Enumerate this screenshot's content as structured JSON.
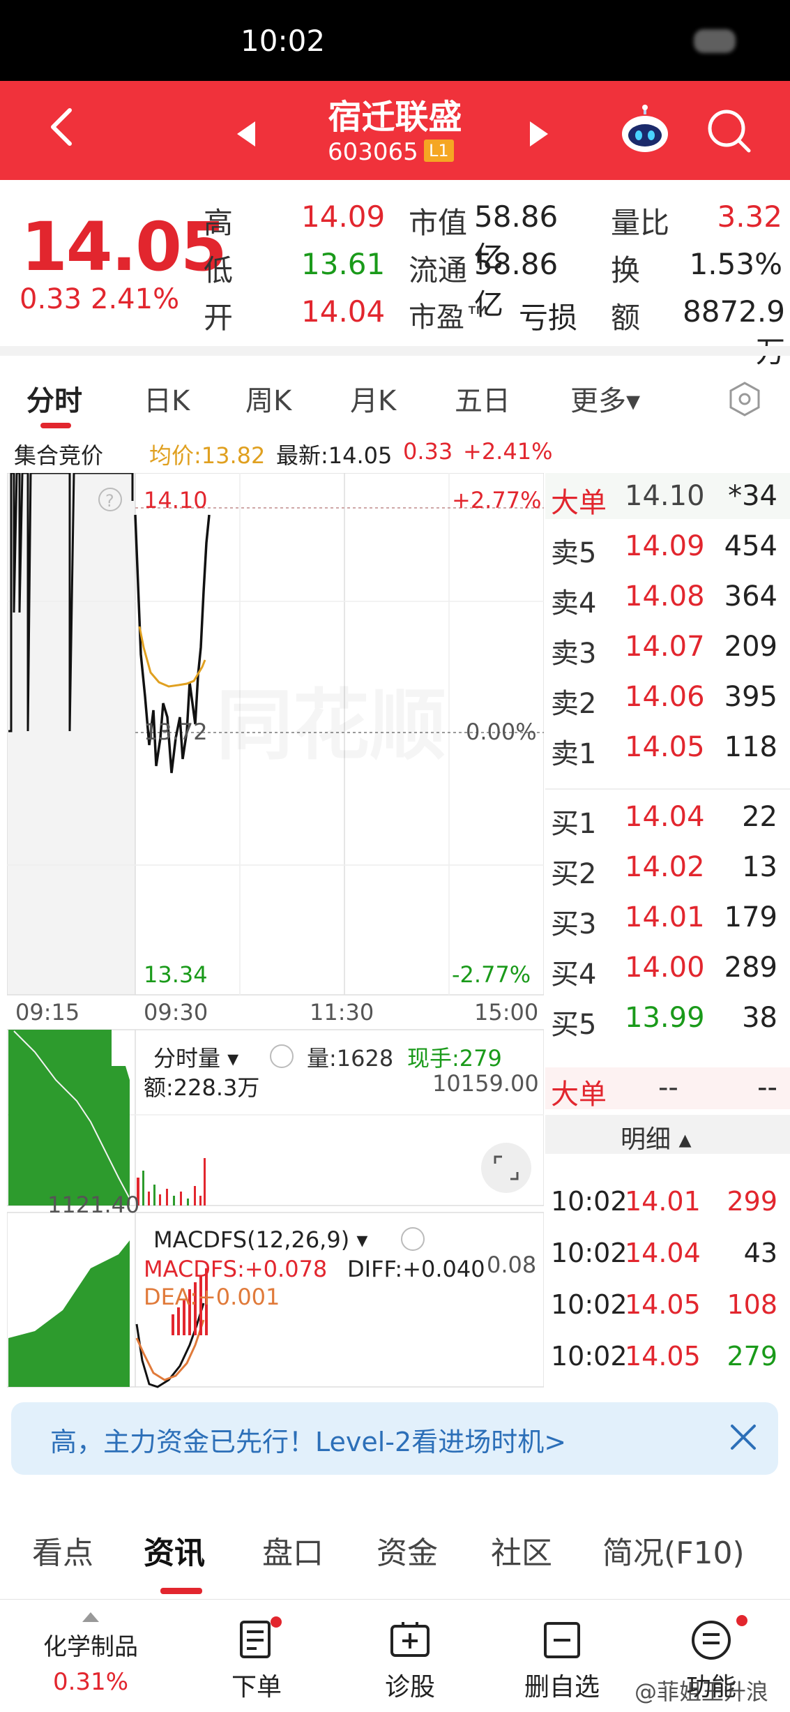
{
  "status_bar": {
    "time": "10:02"
  },
  "header": {
    "stock_name": "宿迁联盛",
    "stock_code": "603065",
    "level_badge": "L1",
    "icons": [
      "back-icon",
      "prev-arrow-icon",
      "next-arrow-icon",
      "robot-assistant-icon",
      "search-icon"
    ]
  },
  "quote": {
    "price": "14.05",
    "change": "0.33",
    "change_pct": "2.41%",
    "fields": [
      {
        "label": "高",
        "value": "14.09",
        "color": "#e2262e"
      },
      {
        "label": "低",
        "value": "13.61",
        "color": "#1a9a1a"
      },
      {
        "label": "开",
        "value": "14.04",
        "color": "#e2262e"
      },
      {
        "label": "市值",
        "value": "58.86亿",
        "color": "#222"
      },
      {
        "label": "流通",
        "value": "58.86亿",
        "color": "#222"
      },
      {
        "label": "市盈™",
        "value": "亏损",
        "color": "#222"
      },
      {
        "label": "量比",
        "value": "3.32",
        "color": "#e2262e"
      },
      {
        "label": "换",
        "value": "1.53%",
        "color": "#222"
      },
      {
        "label": "额",
        "value": "8872.9万",
        "color": "#222"
      }
    ]
  },
  "tabs": [
    {
      "label": "分时",
      "active": true
    },
    {
      "label": "日K"
    },
    {
      "label": "周K"
    },
    {
      "label": "月K"
    },
    {
      "label": "五日"
    },
    {
      "label": "更多▾"
    }
  ],
  "info_row": {
    "auction": "集合竞价",
    "avg": "均价:13.82",
    "latest": "最新:14.05",
    "chg": "0.33",
    "pct": "+2.41%"
  },
  "chart": {
    "price_top": "14.10",
    "price_mid": "13.72",
    "price_bottom": "13.34",
    "pct_top": "+2.77%",
    "pct_mid": "0.00%",
    "pct_bottom": "-2.77%",
    "times": [
      "09:15",
      "09:30",
      "11:30",
      "15:00"
    ],
    "watermark": "同花顺",
    "volume_indicator": "分时量 ▾",
    "volume": "量:1628",
    "current_hand": "现手:279",
    "amount": "额:228.3万",
    "vol_max": "10159.00",
    "vol_mid": "1121.40",
    "macd_label": "MACDFS(12,26,9) ▾",
    "macdfs": "MACDFS:+0.078",
    "diff": "DIFF:+0.040",
    "dea": "DEA:+0.001",
    "macd_right": "0.08",
    "colors": {
      "up": "#e2262e",
      "down": "#1a9a1a",
      "avg": "#e0a020"
    }
  },
  "order_book": {
    "big_top": {
      "label": "大单",
      "price": "14.10",
      "vol": "*34"
    },
    "asks": [
      {
        "label": "卖5",
        "price": "14.09",
        "vol": "454"
      },
      {
        "label": "卖4",
        "price": "14.08",
        "vol": "364"
      },
      {
        "label": "卖3",
        "price": "14.07",
        "vol": "209"
      },
      {
        "label": "卖2",
        "price": "14.06",
        "vol": "395"
      },
      {
        "label": "卖1",
        "price": "14.05",
        "vol": "118"
      }
    ],
    "bids": [
      {
        "label": "买1",
        "price": "14.04",
        "vol": "22"
      },
      {
        "label": "买2",
        "price": "14.02",
        "vol": "13"
      },
      {
        "label": "买3",
        "price": "14.01",
        "vol": "179"
      },
      {
        "label": "买4",
        "price": "14.00",
        "vol": "289"
      },
      {
        "label": "买5",
        "price": "13.99",
        "vol": "38"
      }
    ],
    "big_bottom": {
      "label": "大单",
      "price": "--",
      "vol": "--"
    },
    "detail_header": "明细 ▴",
    "details": [
      {
        "time": "10:02",
        "price": "14.01",
        "vol": "299",
        "price_color": "#e2262e",
        "vol_color": "#e2262e"
      },
      {
        "time": "10:02",
        "price": "14.04",
        "vol": "43",
        "price_color": "#e2262e",
        "vol_color": "#222"
      },
      {
        "time": "10:02",
        "price": "14.05",
        "vol": "108",
        "price_color": "#e2262e",
        "vol_color": "#e2262e"
      },
      {
        "time": "10:02",
        "price": "14.05",
        "vol": "279",
        "price_color": "#e2262e",
        "vol_color": "#1a9a1a"
      }
    ]
  },
  "banner": {
    "text": "高，主力资金已先行！Level-2看进场时机>"
  },
  "bottom_tabs": [
    {
      "label": "看点"
    },
    {
      "label": "资讯",
      "active": true
    },
    {
      "label": "盘口"
    },
    {
      "label": "资金"
    },
    {
      "label": "社区"
    },
    {
      "label": "简况(F10)"
    }
  ],
  "nav": [
    {
      "label": "化学制品",
      "sub": "0.31%"
    },
    {
      "label": "下单"
    },
    {
      "label": "诊股"
    },
    {
      "label": "删自选"
    },
    {
      "label": "功能"
    }
  ],
  "watermark_text": "@菲姐王升浪"
}
